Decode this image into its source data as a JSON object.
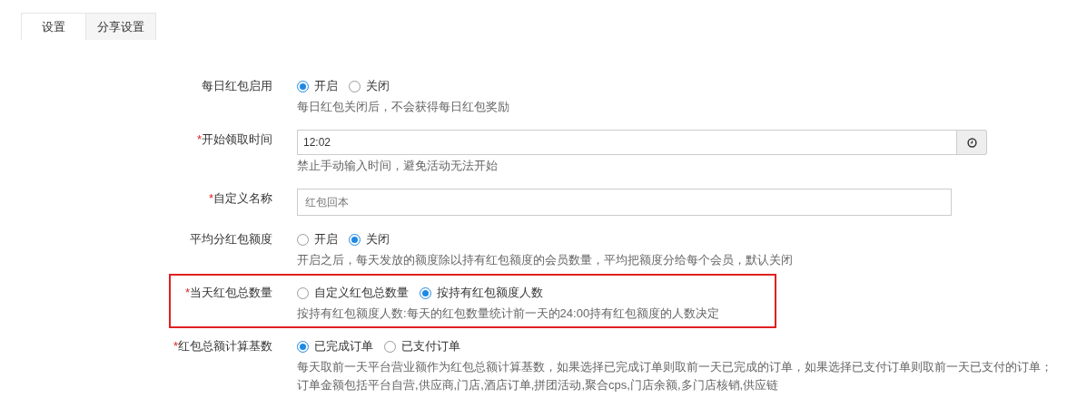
{
  "tabs": [
    {
      "label": "设置",
      "selected": true
    },
    {
      "label": "分享设置",
      "selected": false
    }
  ],
  "form": {
    "rows": [
      {
        "kind": "radio",
        "label": "每日红包启用",
        "options": [
          {
            "label": "开启",
            "selected": true
          },
          {
            "label": "关闭",
            "selected": false
          }
        ],
        "hints": [
          "每日红包关闭后，不会获得每日红包奖励"
        ]
      },
      {
        "kind": "time",
        "required_mark": "*",
        "label": "开始领取时间",
        "value": "12:02",
        "hints": [
          "禁止手动输入时间，避免活动无法开始"
        ]
      },
      {
        "kind": "text",
        "required_mark": "*",
        "label": "自定义名称",
        "placeholder": "红包回本"
      },
      {
        "kind": "radio",
        "label": "平均分红包额度",
        "options": [
          {
            "label": "开启",
            "selected": false
          },
          {
            "label": "关闭",
            "selected": true
          }
        ],
        "hints": [
          "开启之后，每天发放的额度除以持有红包额度的会员数量，平均把额度分给每个会员，默认关闭"
        ]
      },
      {
        "kind": "radio",
        "required_mark": "*",
        "label": "当天红包总数量",
        "highlighted": true,
        "options": [
          {
            "label": "自定义红包总数量",
            "selected": false
          },
          {
            "label": "按持有红包额度人数",
            "selected": true
          }
        ],
        "hints": [
          "按持有红包额度人数:每天的红包数量统计前一天的24:00持有红包额度的人数决定"
        ]
      },
      {
        "kind": "radio",
        "required_mark": "*",
        "label": "红包总额计算基数",
        "options": [
          {
            "label": "已完成订单",
            "selected": true
          },
          {
            "label": "已支付订单",
            "selected": false
          }
        ],
        "hints": [
          "每天取前一天平台营业额作为红包总额计算基数，如果选择已完成订单则取前一天已完成的订单，如果选择已支付订单则取前一天已支付的订单；",
          "订单金额包括平台自营,供应商,门店,酒店订单,拼团活动,聚合cps,门店余额,多门店核销,供应链"
        ]
      }
    ]
  }
}
